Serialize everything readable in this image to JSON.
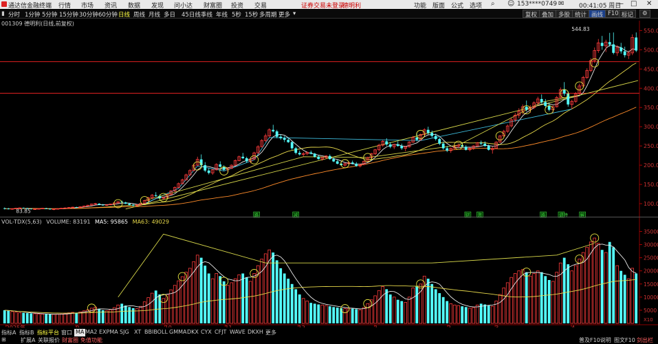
{
  "window": {
    "title": "通达信金融终端",
    "menu": [
      "行情",
      "市场",
      "资讯",
      "数据",
      "发现",
      "问小达",
      "财富圈",
      "投资",
      "交易"
    ],
    "login_status": "证券交易未登录",
    "stock_name": "德明利",
    "right_menu": [
      "功能",
      "版面",
      "公式",
      "选项"
    ],
    "user": "153****0749",
    "clock": "00:41:05 周日"
  },
  "period_bar": {
    "items": [
      "分时",
      "1分钟",
      "5分钟",
      "15分钟",
      "30分钟",
      "60分钟",
      "日线",
      "周线",
      "月线",
      "多日",
      "季线",
      "年线",
      "5秒",
      "15秒",
      "多周期",
      "更多"
    ],
    "active": "日线",
    "right_buttons": [
      "复权",
      "叠加",
      "多股",
      "统计",
      "画线",
      "F10",
      "标记"
    ]
  },
  "chart_header": "001309 德明利(日线,前复权)",
  "volume_header": {
    "label": "VOL-TDX(5,63)",
    "volume": "VOLUME: 83191",
    "ma5": "MA5: 95865",
    "ma63": "MA63: 49029"
  },
  "colors": {
    "up": "#ff3c3c",
    "down": "#54ffff",
    "ma_main": "#e8e8e8",
    "ma_yellow": "#e6d84a",
    "ma_orange": "#ff8c2a",
    "trendline_cyan": "#3fbfe0",
    "trendline_yellow": "#d8d84a",
    "marker": "#e8e440",
    "hline": "#e02020",
    "event": "#40d040",
    "grid": "#8b0000"
  },
  "chart_data": {
    "type": "candlestick",
    "price_axis": {
      "ticks": [
        550.0,
        500.0,
        450.0,
        400.0,
        350.0,
        300.0,
        250.0,
        200.0,
        150.0,
        100.0
      ],
      "ylim": [
        75,
        565
      ],
      "labels": [
        "550.0",
        "500.0",
        "450.0",
        "400.0",
        "350.0",
        "300.0",
        "250.0",
        "200.0",
        "150.0",
        "100.0"
      ]
    },
    "price_annotations": {
      "high": "544.83",
      "low": "83.85"
    },
    "horizontal_lines": [
      469,
      387
    ],
    "volume_axis": {
      "ticks": [
        35000,
        30000,
        25000,
        20000,
        15000,
        10000,
        5000
      ],
      "labels": [
        "35000",
        "30000",
        "25000",
        "20000",
        "15000",
        "10000",
        "5000"
      ],
      "ylim": [
        0,
        38000
      ],
      "unit": "X10"
    },
    "x_labels": [
      "2025年",
      "9",
      "10",
      "11",
      "12",
      "1",
      "2",
      "3",
      "4"
    ],
    "events": [
      "路",
      "减",
      "财",
      "激",
      "路",
      "调持",
      "解"
    ],
    "candles": [
      [
        88,
        90,
        85,
        87,
        5000
      ],
      [
        87,
        89,
        85,
        86,
        4800
      ],
      [
        86,
        88,
        84,
        87,
        4500
      ],
      [
        87,
        89,
        86,
        88,
        4300
      ],
      [
        88,
        90,
        86,
        89,
        4100
      ],
      [
        89,
        90,
        87,
        88,
        4000
      ],
      [
        88,
        89,
        86,
        87,
        3900
      ],
      [
        87,
        88,
        85,
        86,
        3800
      ],
      [
        86,
        87,
        84,
        86,
        3700
      ],
      [
        86,
        88,
        85,
        87,
        3600
      ],
      [
        87,
        89,
        86,
        88,
        3500
      ],
      [
        88,
        89,
        86,
        87,
        3500
      ],
      [
        87,
        88,
        85,
        85,
        3400
      ],
      [
        85,
        87,
        83,
        86,
        3400
      ],
      [
        86,
        88,
        85,
        87,
        3500
      ],
      [
        87,
        89,
        86,
        88,
        3600
      ],
      [
        88,
        90,
        87,
        89,
        3800
      ],
      [
        89,
        91,
        88,
        90,
        4000
      ],
      [
        90,
        92,
        88,
        91,
        4200
      ],
      [
        91,
        92,
        89,
        90,
        4100
      ],
      [
        90,
        93,
        89,
        92,
        4400
      ],
      [
        92,
        95,
        91,
        94,
        4800
      ],
      [
        94,
        97,
        93,
        96,
        5200
      ],
      [
        96,
        100,
        95,
        99,
        5800
      ],
      [
        99,
        102,
        97,
        100,
        6200
      ],
      [
        100,
        101,
        96,
        97,
        5500
      ],
      [
        97,
        99,
        95,
        96,
        5000
      ],
      [
        96,
        98,
        94,
        97,
        4800
      ],
      [
        97,
        100,
        96,
        99,
        5200
      ],
      [
        99,
        103,
        98,
        102,
        6000
      ],
      [
        102,
        106,
        100,
        105,
        7000
      ],
      [
        105,
        108,
        102,
        103,
        7500
      ],
      [
        103,
        105,
        99,
        100,
        6800
      ],
      [
        100,
        102,
        95,
        97,
        6200
      ],
      [
        97,
        99,
        93,
        95,
        5800
      ],
      [
        95,
        98,
        92,
        97,
        5600
      ],
      [
        97,
        102,
        96,
        101,
        6500
      ],
      [
        101,
        110,
        100,
        108,
        8200
      ],
      [
        108,
        118,
        106,
        115,
        9800
      ],
      [
        115,
        125,
        112,
        122,
        11500
      ],
      [
        122,
        130,
        118,
        120,
        12500
      ],
      [
        120,
        124,
        112,
        114,
        11000
      ],
      [
        114,
        118,
        110,
        116,
        9500
      ],
      [
        116,
        126,
        115,
        124,
        11000
      ],
      [
        124,
        135,
        122,
        133,
        12800
      ],
      [
        133,
        145,
        130,
        142,
        14500
      ],
      [
        142,
        155,
        140,
        152,
        16200
      ],
      [
        152,
        165,
        150,
        162,
        17800
      ],
      [
        162,
        178,
        160,
        175,
        19500
      ],
      [
        175,
        190,
        172,
        186,
        21000
      ],
      [
        186,
        204,
        184,
        200,
        23500
      ],
      [
        200,
        222,
        198,
        215,
        26000
      ],
      [
        215,
        228,
        196,
        200,
        25000
      ],
      [
        200,
        208,
        182,
        186,
        22000
      ],
      [
        186,
        192,
        176,
        180,
        19000
      ],
      [
        180,
        190,
        175,
        188,
        17000
      ],
      [
        188,
        205,
        186,
        202,
        19000
      ],
      [
        202,
        210,
        194,
        196,
        18000
      ],
      [
        196,
        200,
        185,
        188,
        16000
      ],
      [
        188,
        195,
        182,
        192,
        14500
      ],
      [
        192,
        202,
        190,
        200,
        15500
      ],
      [
        200,
        215,
        198,
        212,
        17000
      ],
      [
        212,
        225,
        210,
        222,
        18500
      ],
      [
        222,
        232,
        216,
        218,
        19000
      ],
      [
        218,
        222,
        206,
        210,
        17500
      ],
      [
        210,
        218,
        205,
        216,
        16000
      ],
      [
        216,
        235,
        214,
        232,
        19000
      ],
      [
        232,
        252,
        230,
        248,
        22000
      ],
      [
        248,
        268,
        246,
        264,
        24500
      ],
      [
        264,
        282,
        260,
        276,
        26500
      ],
      [
        276,
        296,
        272,
        292,
        28000
      ],
      [
        292,
        305,
        285,
        288,
        27000
      ],
      [
        288,
        292,
        270,
        274,
        24000
      ],
      [
        274,
        280,
        266,
        270,
        21000
      ],
      [
        270,
        276,
        260,
        266,
        19000
      ],
      [
        266,
        272,
        258,
        260,
        17000
      ],
      [
        260,
        262,
        240,
        244,
        15000
      ],
      [
        244,
        248,
        228,
        232,
        13000
      ],
      [
        232,
        238,
        225,
        228,
        11000
      ],
      [
        228,
        234,
        222,
        230,
        9500
      ],
      [
        230,
        236,
        226,
        233,
        8500
      ],
      [
        233,
        238,
        228,
        230,
        7800
      ],
      [
        230,
        232,
        220,
        222,
        7500
      ],
      [
        222,
        226,
        214,
        216,
        7200
      ],
      [
        216,
        222,
        212,
        220,
        7000
      ],
      [
        220,
        226,
        216,
        224,
        6800
      ],
      [
        224,
        228,
        214,
        216,
        6500
      ],
      [
        216,
        220,
        208,
        210,
        6200
      ],
      [
        210,
        214,
        202,
        204,
        6000
      ],
      [
        204,
        208,
        198,
        200,
        5800
      ],
      [
        200,
        206,
        196,
        204,
        5600
      ],
      [
        204,
        210,
        200,
        207,
        5800
      ],
      [
        207,
        212,
        202,
        204,
        5600
      ],
      [
        204,
        208,
        196,
        198,
        5400
      ],
      [
        198,
        204,
        194,
        202,
        5200
      ],
      [
        202,
        212,
        200,
        210,
        6000
      ],
      [
        210,
        222,
        208,
        220,
        7500
      ],
      [
        220,
        232,
        216,
        230,
        9000
      ],
      [
        230,
        242,
        226,
        240,
        10500
      ],
      [
        240,
        256,
        236,
        252,
        12500
      ],
      [
        252,
        266,
        248,
        262,
        14000
      ],
      [
        262,
        270,
        250,
        254,
        13000
      ],
      [
        254,
        260,
        244,
        248,
        11000
      ],
      [
        248,
        256,
        242,
        254,
        10000
      ],
      [
        254,
        262,
        248,
        250,
        9000
      ],
      [
        250,
        256,
        240,
        244,
        8500
      ],
      [
        244,
        250,
        236,
        248,
        8000
      ],
      [
        248,
        262,
        246,
        260,
        10000
      ],
      [
        260,
        276,
        258,
        272,
        13500
      ],
      [
        272,
        284,
        262,
        266,
        14000
      ],
      [
        266,
        282,
        264,
        280,
        15000
      ],
      [
        280,
        296,
        276,
        292,
        18000
      ],
      [
        292,
        300,
        280,
        284,
        17000
      ],
      [
        284,
        290,
        272,
        276,
        15000
      ],
      [
        276,
        282,
        264,
        268,
        13000
      ],
      [
        268,
        272,
        252,
        256,
        11500
      ],
      [
        256,
        262,
        240,
        244,
        10000
      ],
      [
        244,
        250,
        234,
        238,
        8500
      ],
      [
        238,
        246,
        232,
        244,
        7500
      ],
      [
        244,
        252,
        240,
        249,
        7000
      ],
      [
        249,
        256,
        244,
        252,
        6800
      ],
      [
        252,
        258,
        246,
        248,
        6500
      ],
      [
        248,
        252,
        238,
        240,
        6200
      ],
      [
        240,
        246,
        236,
        244,
        5800
      ],
      [
        244,
        252,
        240,
        250,
        6000
      ],
      [
        250,
        260,
        248,
        258,
        7000
      ],
      [
        258,
        264,
        252,
        256,
        7500
      ],
      [
        256,
        262,
        248,
        250,
        7200
      ],
      [
        250,
        254,
        238,
        240,
        6800
      ],
      [
        240,
        248,
        230,
        244,
        6500
      ],
      [
        244,
        262,
        242,
        260,
        8500
      ],
      [
        260,
        278,
        258,
        276,
        11000
      ],
      [
        276,
        292,
        272,
        288,
        13500
      ],
      [
        288,
        306,
        284,
        302,
        15500
      ],
      [
        302,
        322,
        298,
        318,
        17500
      ],
      [
        318,
        336,
        312,
        330,
        19000
      ],
      [
        330,
        348,
        322,
        340,
        20000
      ],
      [
        340,
        358,
        332,
        352,
        20500
      ],
      [
        352,
        368,
        340,
        344,
        19500
      ],
      [
        344,
        356,
        336,
        350,
        18000
      ],
      [
        350,
        366,
        346,
        362,
        19000
      ],
      [
        362,
        378,
        356,
        372,
        20000
      ],
      [
        372,
        384,
        360,
        364,
        19500
      ],
      [
        364,
        372,
        350,
        354,
        18000
      ],
      [
        354,
        362,
        340,
        344,
        16500
      ],
      [
        344,
        356,
        336,
        352,
        16000
      ],
      [
        352,
        380,
        350,
        376,
        19500
      ],
      [
        376,
        402,
        372,
        396,
        23000
      ],
      [
        396,
        416,
        380,
        386,
        25000
      ],
      [
        386,
        392,
        352,
        358,
        22500
      ],
      [
        358,
        370,
        346,
        366,
        20000
      ],
      [
        366,
        390,
        362,
        386,
        22000
      ],
      [
        386,
        412,
        382,
        406,
        24500
      ],
      [
        406,
        432,
        402,
        428,
        27000
      ],
      [
        428,
        452,
        424,
        446,
        29000
      ],
      [
        446,
        478,
        442,
        472,
        31000
      ],
      [
        472,
        506,
        466,
        498,
        32500
      ],
      [
        498,
        528,
        492,
        518,
        30500
      ],
      [
        518,
        536,
        500,
        510,
        28000
      ],
      [
        510,
        526,
        494,
        520,
        27000
      ],
      [
        520,
        544,
        508,
        514,
        31000
      ],
      [
        514,
        545,
        488,
        492,
        29000
      ],
      [
        492,
        512,
        484,
        506,
        22000
      ],
      [
        506,
        518,
        490,
        496,
        20000
      ],
      [
        496,
        508,
        480,
        486,
        18500
      ],
      [
        486,
        498,
        476,
        492,
        17000
      ],
      [
        492,
        540,
        486,
        532,
        21000
      ],
      [
        532,
        545,
        494,
        498,
        19000
      ]
    ]
  }
}
